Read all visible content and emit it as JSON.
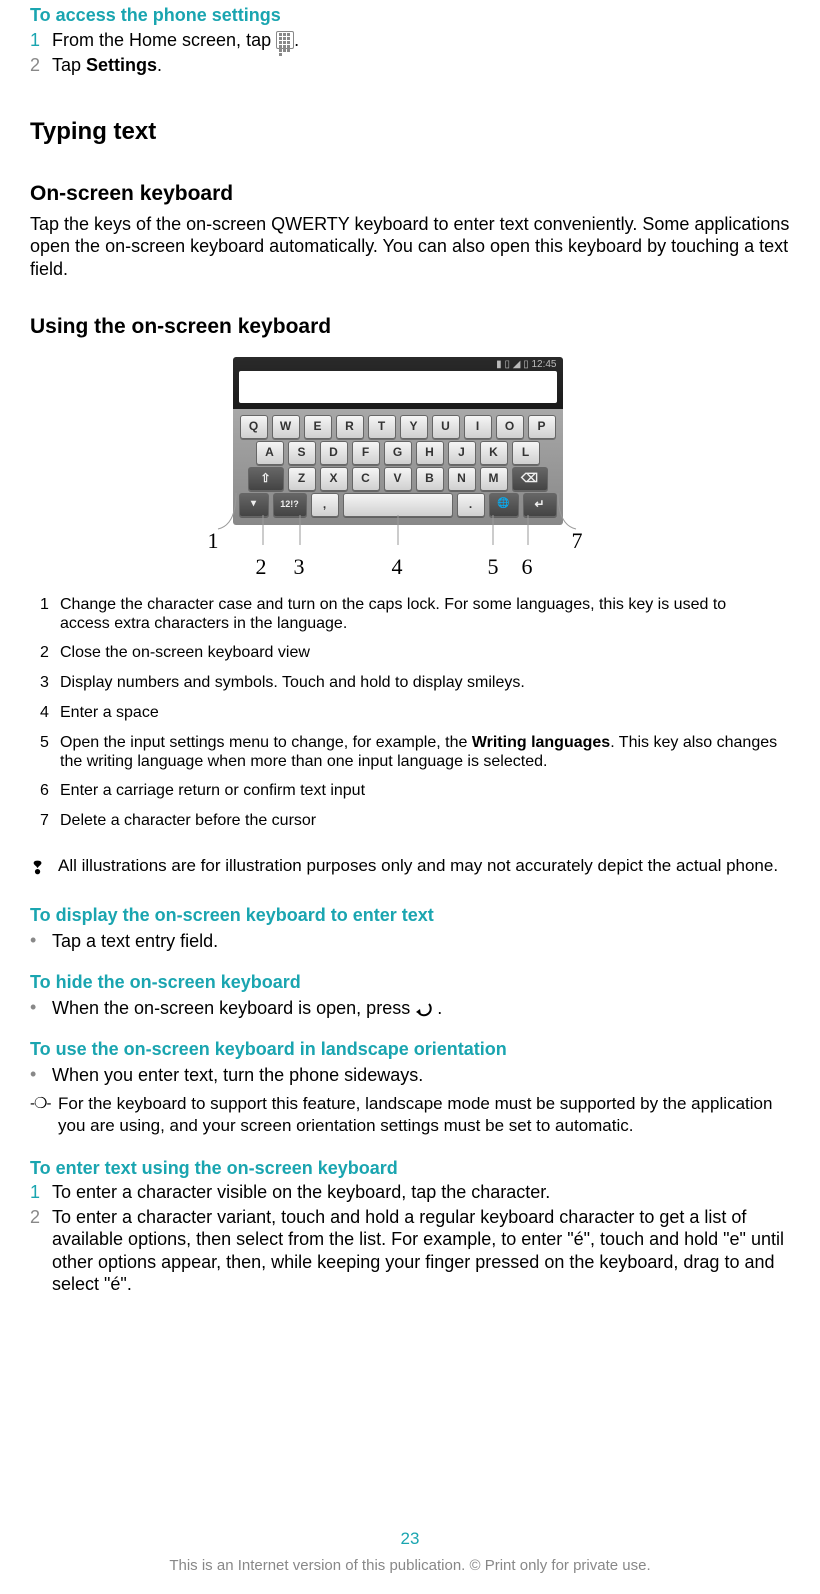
{
  "access": {
    "title": "To access the phone settings",
    "steps": [
      {
        "n": "1",
        "text_a": "From the Home screen, tap ",
        "text_b": "."
      },
      {
        "n": "2",
        "text_a": "Tap ",
        "bold": "Settings",
        "text_b": "."
      }
    ]
  },
  "typing_heading": "Typing text",
  "osk_heading": "On-screen keyboard",
  "osk_intro": "Tap the keys of the on-screen QWERTY keyboard to enter text conveniently. Some applications open the on-screen keyboard automatically. You can also open this keyboard by touching a text field.",
  "using_heading": "Using the on-screen keyboard",
  "keyboard": {
    "status": "12:45",
    "row1": [
      "Q",
      "W",
      "E",
      "R",
      "T",
      "Y",
      "U",
      "I",
      "O",
      "P"
    ],
    "row2": [
      "A",
      "S",
      "D",
      "F",
      "G",
      "H",
      "J",
      "K",
      "L"
    ],
    "row3_mid": [
      "Z",
      "X",
      "C",
      "V",
      "B",
      "N",
      "M"
    ],
    "labels": {
      "l1": "1",
      "l2": "2",
      "l3": "3",
      "l4": "4",
      "l5": "5",
      "l6": "6",
      "l7": "7"
    }
  },
  "legend": [
    {
      "n": "1",
      "t": "Change the character case and turn on the caps lock. For some languages, this key is used to access extra characters in the language."
    },
    {
      "n": "2",
      "t": "Close the on-screen keyboard view"
    },
    {
      "n": "3",
      "t": "Display numbers and symbols. Touch and hold to display smileys."
    },
    {
      "n": "4",
      "t": "Enter a space"
    },
    {
      "n": "5",
      "t_a": "Open the input settings menu to change, for example, the ",
      "bold": "Writing languages",
      "t_b": ". This key also changes the writing language when more than one input language is selected."
    },
    {
      "n": "6",
      "t": "Enter a carriage return or confirm text input"
    },
    {
      "n": "7",
      "t": "Delete a character before the cursor"
    }
  ],
  "illus_note": "All illustrations are for illustration purposes only and may not accurately depict the actual phone.",
  "tasks": {
    "display": {
      "title": "To display the on-screen keyboard to enter text",
      "bullet": "Tap a text entry field."
    },
    "hide": {
      "title": "To hide the on-screen keyboard",
      "bullet_a": "When the on-screen keyboard is open, press ",
      "bullet_b": "."
    },
    "landscape": {
      "title": "To use the on-screen keyboard in landscape orientation",
      "bullet": "When you enter text, turn the phone sideways."
    },
    "landscape_tip": "For the keyboard to support this feature, landscape mode must be supported by the application you are using, and your screen orientation settings must be set to automatic.",
    "enter": {
      "title": "To enter text using the on-screen keyboard",
      "steps": [
        {
          "n": "1",
          "t": "To enter a character visible on the keyboard, tap the character."
        },
        {
          "n": "2",
          "t": "To enter a character variant, touch and hold a regular keyboard character to get a list of available options, then select from the list. For example, to enter \"é\", touch and hold \"e\" until other options appear, then, while keeping your finger pressed on the keyboard, drag to and select \"é\"."
        }
      ]
    }
  },
  "page_number": "23",
  "footer": "This is an Internet version of this publication. © Print only for private use."
}
